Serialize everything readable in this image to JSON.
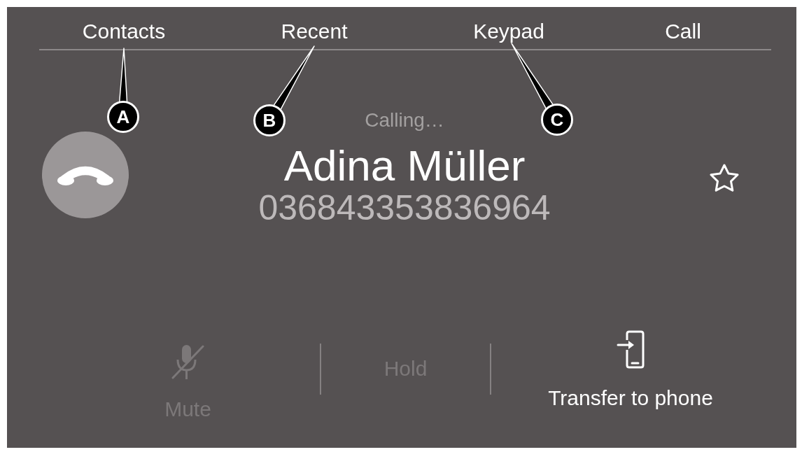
{
  "tabs": [
    {
      "label": "Contacts"
    },
    {
      "label": "Recent"
    },
    {
      "label": "Keypad"
    },
    {
      "label": "Call"
    }
  ],
  "callouts": [
    {
      "label": "A"
    },
    {
      "label": "B"
    },
    {
      "label": "C"
    }
  ],
  "call": {
    "status": "Calling…",
    "name": "Adina Müller",
    "number": "036843353836964",
    "favorite": false
  },
  "actions": [
    {
      "kind": "mute",
      "label": "Mute",
      "disabled": true
    },
    {
      "kind": "hold",
      "label": "Hold",
      "disabled": true
    },
    {
      "kind": "transfer",
      "label": "Transfer to phone",
      "disabled": false
    }
  ]
}
